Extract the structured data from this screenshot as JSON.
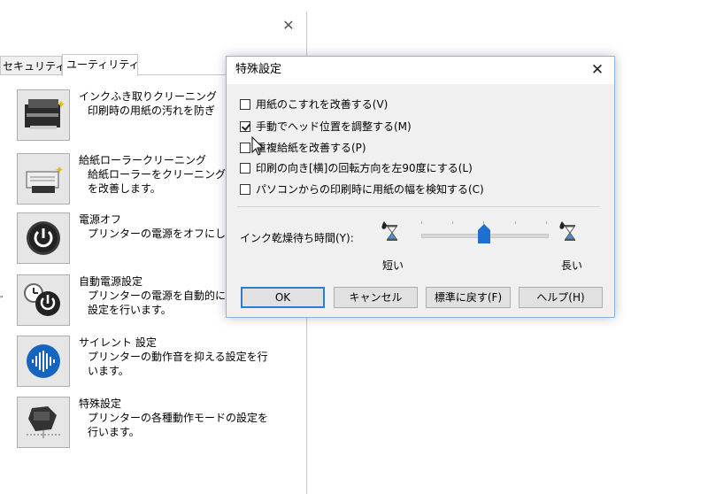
{
  "bg_window": {
    "tabs": {
      "security": "セキュリティ",
      "utility": "ユーティリティ"
    },
    "items": [
      {
        "title": "インクふき取りクリーニング",
        "desc": "印刷時の用紙の汚れを防ぎ",
        "icon": "printer-cleaning-icon"
      },
      {
        "title": "給紙ローラークリーニング",
        "desc": "給紙ローラーをクリーニングし\nを改善します。",
        "icon": "feed-roller-icon"
      },
      {
        "title": "電源オフ",
        "desc": "プリンターの電源をオフにしま",
        "icon": "power-icon"
      },
      {
        "title": "自動電源設定",
        "desc": "プリンターの電源を自動的に\n設定を行います。",
        "icon": "auto-power-icon"
      },
      {
        "title": "サイレント 設定",
        "desc": "プリンターの動作音を抑える設定を行\nいます。",
        "icon": "silent-mode-icon"
      },
      {
        "title": "特殊設定",
        "desc": "プリンターの各種動作モードの設定を\n行います。",
        "icon": "special-settings-icon"
      }
    ],
    "side_glyph": "ﾞ"
  },
  "dialog": {
    "title": "特殊設定",
    "options": [
      {
        "label": "用紙のこすれを改善する(V)",
        "checked": false
      },
      {
        "label": "手動でヘッド位置を調整する(M)",
        "checked": true
      },
      {
        "label": "重複給紙を改善する(P)",
        "checked": false
      },
      {
        "label": "印刷の向き[横]の回転方向を左90度にする(L)",
        "checked": false
      },
      {
        "label": "パソコンからの印刷時に用紙の幅を検知する(C)",
        "checked": false
      }
    ],
    "ink_dry": {
      "label": "インク乾燥待ち時間(Y):",
      "short_label": "短い",
      "long_label": "長い",
      "level_fraction": 0.5
    },
    "buttons": {
      "ok": "OK",
      "cancel": "キャンセル",
      "reset": "標準に戻す(F)",
      "help": "ヘルプ(H)"
    }
  },
  "colors": {
    "accent": "#2f7bd0",
    "slider_thumb": "#1f6fd1",
    "dialog_bg": "#f0f0f0"
  }
}
